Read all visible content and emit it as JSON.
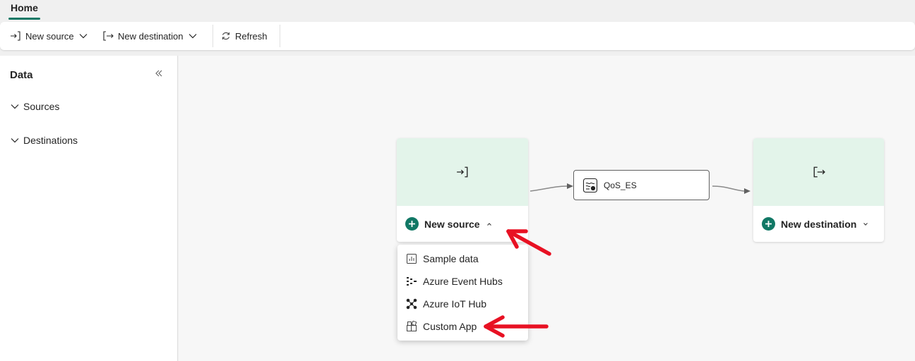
{
  "tabs": {
    "home": "Home"
  },
  "toolbar": {
    "new_source": "New source",
    "new_destination": "New destination",
    "refresh": "Refresh"
  },
  "sidebar": {
    "title": "Data",
    "sections": [
      {
        "label": "Sources"
      },
      {
        "label": "Destinations"
      }
    ]
  },
  "canvas": {
    "source_node": {
      "label": "New source"
    },
    "stream_node": {
      "label": "QoS_ES"
    },
    "destination_node": {
      "label": "New destination"
    },
    "source_menu": {
      "items": [
        {
          "label": "Sample data",
          "icon": "sample-data-icon"
        },
        {
          "label": "Azure Event Hubs",
          "icon": "event-hubs-icon"
        },
        {
          "label": "Azure IoT Hub",
          "icon": "iot-hub-icon"
        },
        {
          "label": "Custom App",
          "icon": "custom-app-icon"
        }
      ]
    }
  },
  "colors": {
    "accent": "#117865",
    "node_header": "#e3f4ea",
    "annotation_arrow": "#e81123"
  }
}
